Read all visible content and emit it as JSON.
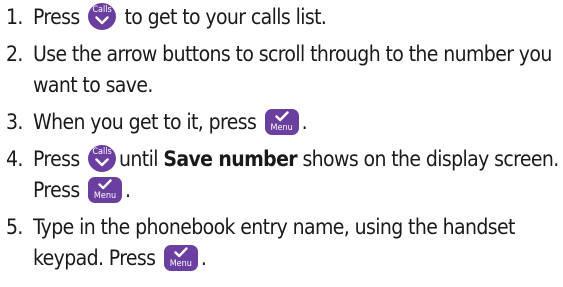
{
  "keys": {
    "calls_label": "Calls",
    "menu_label": "Menu",
    "accent_color": "#6b3fa0"
  },
  "steps": [
    {
      "number": "1.",
      "before": "Press",
      "after": "to get to your calls list."
    },
    {
      "number": "2.",
      "text": "Use the arrow buttons to scroll through to the number you want to save."
    },
    {
      "number": "3.",
      "before": "When you get to it, press",
      "after": "."
    },
    {
      "number": "4.",
      "before": "Press",
      "middle": "until",
      "bold": "Save number",
      "rest": "shows on the display screen. Press",
      "after": "."
    },
    {
      "number": "5.",
      "before": "Type in the phonebook entry name, using the handset keypad. Press",
      "after": "."
    }
  ]
}
